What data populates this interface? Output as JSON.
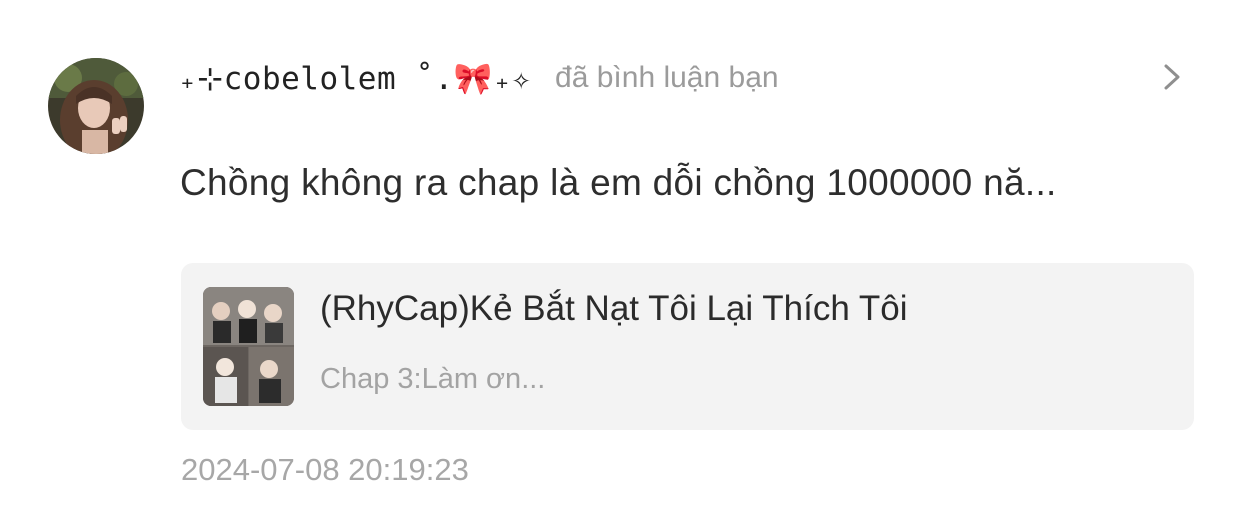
{
  "notification": {
    "username": "⁺‧₊˚.🎀₊✧",
    "username_display": "₊⊹cobelolem ˚.🎀₊✧",
    "action_text": "đã bình luận bạn",
    "comment_text": "Chồng không ra chap là em dỗi chồng 1000000 nă...",
    "timestamp": "2024-07-08 20:19:23"
  },
  "manga_card": {
    "title": "(RhyCap)Kẻ Bắt Nạt Tôi Lại Thích Tôi",
    "chapter": "Chap 3:Làm ơn..."
  },
  "icons": {
    "avatar": "user-avatar",
    "chevron": "chevron-right-icon",
    "cover": "manga-cover-image"
  },
  "colors": {
    "card_background": "#f3f3f3",
    "muted_text": "#a3a3a3",
    "primary_text": "#2b2b2b"
  }
}
